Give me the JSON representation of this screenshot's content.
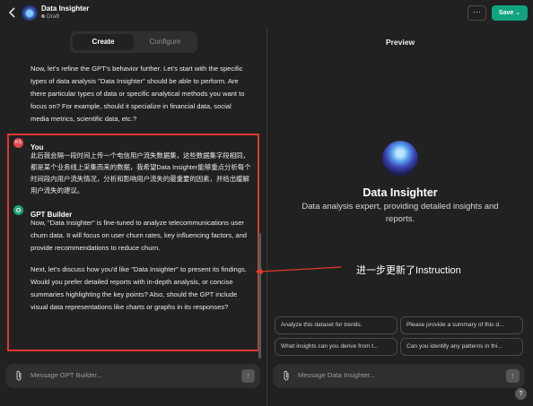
{
  "header": {
    "title": "Data Insighter",
    "status": "Draft",
    "more_label": "···",
    "save_label": "Save"
  },
  "tabs": {
    "create": "Create",
    "configure": "Configure"
  },
  "chat": {
    "intro": "Now, let's refine the GPT's behavior further. Let's start with the specific types of data analysis \"Data Insighter\" should be able to perform. Are there particular types of data or specific analytical methods you want to focus on? For example, should it specialize in financial data, social media metrics, scientific data, etc.?",
    "you_name": "You",
    "you_message": "此后我会隔一段时间上传一个电信用户流失数据集，这些数据集字段相同，都是某个业务线上采集而来的数据，我希望Data Insighter能够重点分析每个时间段内用户流失情况，分析和影响用户流失的最重要的因素，并给出缓解用户流失的建议。",
    "bot_name": "GPT Builder",
    "bot_message_1": "Now, \"Data Insighter\" is fine-tuned to analyze telecommunications user churn data. It will focus on user churn rates, key influencing factors, and provide recommendations to reduce churn.",
    "bot_message_2": "Next, let's discuss how you'd like \"Data Insighter\" to present its findings. Would you prefer detailed reports with in-depth analysis, or concise summaries highlighting the key points? Also, should the GPT include visual data representations like charts or graphs in its responses?"
  },
  "composer_left": {
    "placeholder": "Message GPT Builder..."
  },
  "preview": {
    "label": "Preview",
    "name": "Data Insighter",
    "description": "Data analysis expert, providing detailed insights and reports.",
    "starters": [
      "Analyze this dataset for trends.",
      "Please provide a summary of this d...",
      "What insights can you derive from t...",
      "Can you identify any patterns in thi..."
    ],
    "composer_placeholder": "Message Data Insighter..."
  },
  "annotation": {
    "text": "进一步更新了Instruction",
    "color": "#e0392d"
  },
  "help_label": "?",
  "colors": {
    "accent": "#10a37f",
    "highlight": "#e0392d",
    "background": "#212121"
  }
}
